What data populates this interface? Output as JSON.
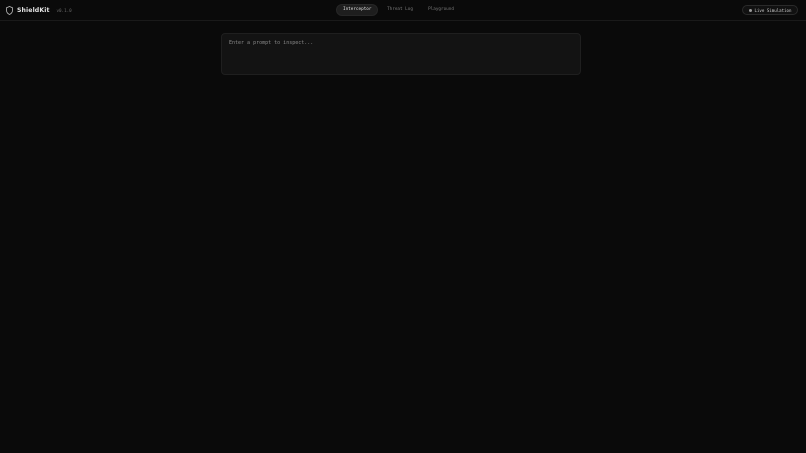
{
  "app": {
    "name": "ShieldKit",
    "version": "v0.1.0",
    "logo_icon": "shield-icon"
  },
  "nav": {
    "tabs": [
      {
        "label": "Interceptor",
        "active": true
      },
      {
        "label": "Threat Log",
        "active": false
      },
      {
        "label": "Playground",
        "active": false
      }
    ]
  },
  "status": {
    "simulation_label": "Live Simulation"
  },
  "prompt": {
    "value": "",
    "placeholder": "Enter a prompt to inspect..."
  },
  "colors": {
    "background": "#0a0a0a",
    "panel": "#131313",
    "text": "#d4d4d4",
    "muted": "#7a7a7a"
  }
}
